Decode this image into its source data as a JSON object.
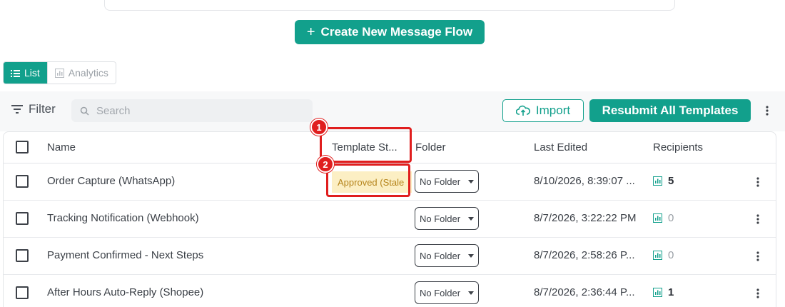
{
  "create_flow": {
    "label": "Create New Message Flow"
  },
  "view_toggle": {
    "list_label": "List",
    "analytics_label": "Analytics"
  },
  "toolbar": {
    "filter_label": "Filter",
    "search_placeholder": "Search",
    "import_label": "Import",
    "resubmit_label": "Resubmit All Templates"
  },
  "table": {
    "headers": {
      "name": "Name",
      "template_status": "Template St...",
      "folder": "Folder",
      "last_edited": "Last Edited",
      "recipients": "Recipients"
    },
    "rows": [
      {
        "name": "Order Capture (WhatsApp)",
        "status": "Approved (Stale",
        "folder": "No Folder",
        "last_edited": "8/10/2026, 8:39:07 ...",
        "recipients": "5"
      },
      {
        "name": "Tracking Notification (Webhook)",
        "status": "",
        "folder": "No Folder",
        "last_edited": "8/7/2026, 3:22:22 PM",
        "recipients": "0"
      },
      {
        "name": "Payment Confirmed - Next Steps",
        "status": "",
        "folder": "No Folder",
        "last_edited": "8/7/2026, 2:58:26 P...",
        "recipients": "0"
      },
      {
        "name": "After Hours Auto-Reply (Shopee)",
        "status": "",
        "folder": "No Folder",
        "last_edited": "8/7/2026, 2:36:44 P...",
        "recipients": "1"
      }
    ]
  },
  "annotations": {
    "one": "1",
    "two": "2"
  },
  "colors": {
    "accent": "#12a08c",
    "annotation": "#e01e1e",
    "badge_bg": "#fcefc4",
    "badge_text": "#b5841b"
  }
}
